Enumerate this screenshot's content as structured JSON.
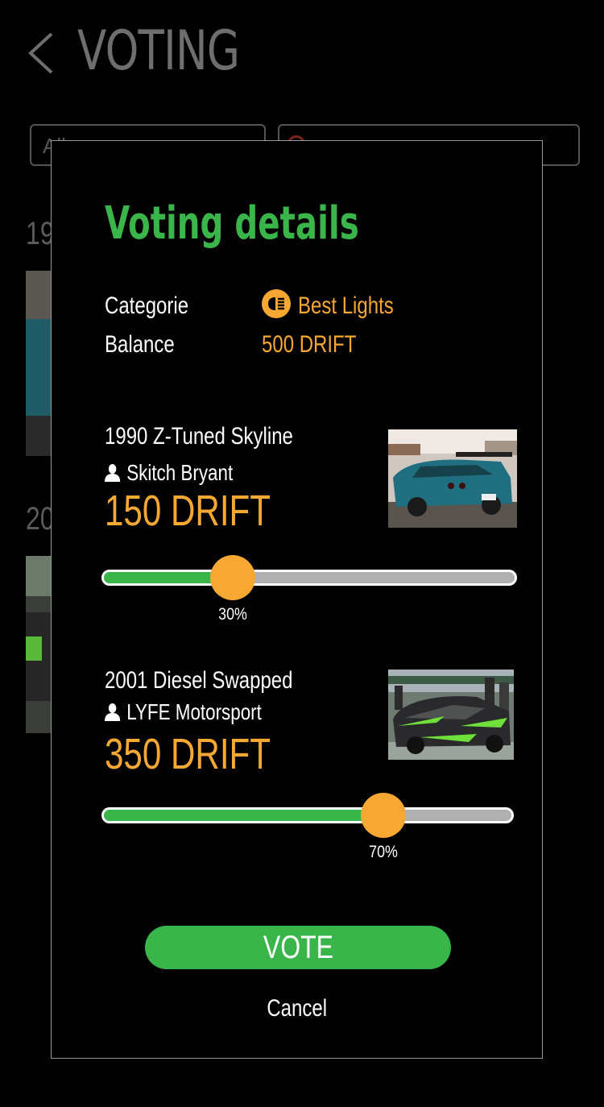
{
  "header": {
    "title": "VOTING"
  },
  "background": {
    "filter_value": "All",
    "entry_1_year": "19",
    "entry_2_year": "20"
  },
  "modal": {
    "title": "Voting details",
    "category_label": "Categorie",
    "category_value": "Best Lights",
    "category_icon": "headlight-icon",
    "balance_label": "Balance",
    "balance_value": "500 DRIFT"
  },
  "votes": [
    {
      "car": "1990 Z-Tuned Skyline",
      "owner": "Skitch Bryant",
      "amount": "150 DRIFT",
      "percent_label": "30%",
      "percent": 30
    },
    {
      "car": "2001 Diesel Swapped",
      "owner": "LYFE Motorsport",
      "amount": "350 DRIFT",
      "percent_label": "70%",
      "percent": 70
    }
  ],
  "actions": {
    "vote_label": "VOTE",
    "cancel_label": "Cancel"
  },
  "colors": {
    "accent_green": "#3ab54a",
    "accent_orange": "#f7a833",
    "slider_track": "#b0b0b0"
  }
}
